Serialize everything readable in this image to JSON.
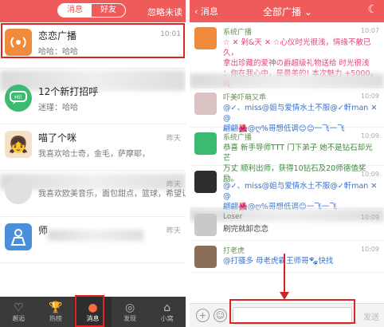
{
  "left": {
    "tabs": [
      "消息",
      "好友"
    ],
    "ignore_unread": "忽略未读",
    "items": [
      {
        "name": "恋恋广播",
        "sub": "哈哈：哈哈",
        "time": "10:01"
      },
      {
        "name": "12个新打招呼",
        "sub": "迷瑾：哈哈",
        "time": ""
      },
      {
        "name": "喵了个咪",
        "sub": "我喜欢哈士奇，金毛，萨摩耶，",
        "time": "昨天"
      },
      {
        "name": "",
        "sub": "我喜欢欧美音乐，面包甜点，篮球，希望认识",
        "time": "昨天"
      },
      {
        "name": "师",
        "sub": "",
        "time": "昨天"
      }
    ],
    "tabbar": [
      {
        "label": "邂逅",
        "icon": "heart-icon"
      },
      {
        "label": "热榜",
        "icon": "trophy-icon"
      },
      {
        "label": "消息",
        "icon": "chat-icon"
      },
      {
        "label": "发现",
        "icon": "planet-icon"
      },
      {
        "label": "小窝",
        "icon": "home-icon"
      }
    ]
  },
  "right": {
    "back": "消息",
    "title": "全部广播",
    "messages": [
      {
        "name": "系统广播",
        "time": "10:07",
        "lines": [
          "☆ ✕ 剁&天 ✕ ☆心仪时光很浅，情缘不散已久，",
          "拿出珍藏的爱神の爵超级礼物送给 时光很浅 ",
          "：你在我心中，是最美的! 本次魅力 +5000，再"
        ]
      },
      {
        "name": "吓美吓萌又乖",
        "time": "10:09",
        "lines": [
          "@✓、miss@姐与爱情水土不服@✓軒man ✕ @",
          "翩翩🌺@ღ%哥想低调😊😊一飞一飞"
        ]
      },
      {
        "name": "系统广播",
        "time": "10:09",
        "lines": [
          "恭喜 新手导师TTT 门下弟子 她不是钻石却光芒",
          "万丈 顺利出师，获得10钻石及20师德值奖励。"
        ]
      },
      {
        "name": "",
        "time": "10:09",
        "lines": [
          "@✓、miss@姐与爱情水土不服@✓軒man ✕ @",
          "翩翩🌺@ღ%哥想低调😊一飞一飞"
        ]
      },
      {
        "name": "Loser",
        "time": "10:09",
        "lines": [
          "刷完就卸恋恋"
        ]
      },
      {
        "name": "打老虎",
        "time": "10:09",
        "lines": [
          "@打骚多 母老虎霸王师哥🐾快找"
        ]
      }
    ],
    "send": "发送"
  }
}
